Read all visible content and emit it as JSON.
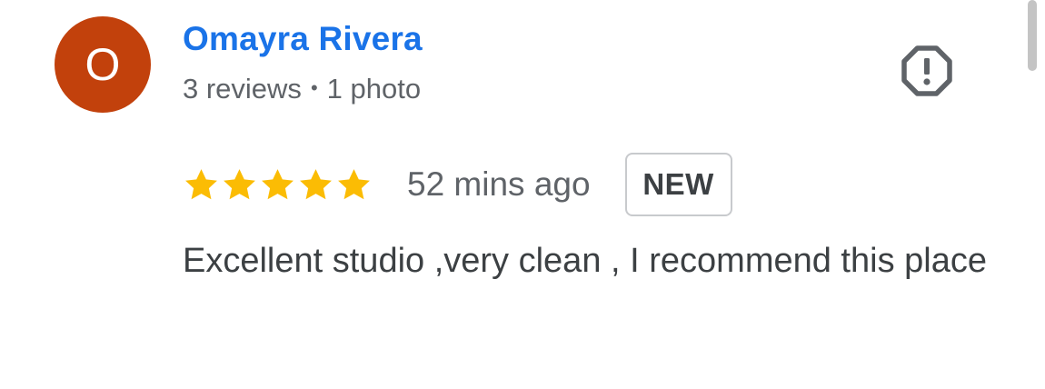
{
  "reviewer": {
    "initial": "O",
    "avatar_color": "#c2410c",
    "name": "Omayra Rivera",
    "name_color": "#1a73e8",
    "reviews_count": "3 reviews",
    "separator": "•",
    "photos_count": "1 photo"
  },
  "report": {
    "icon": "report-flag-octagon-icon"
  },
  "review": {
    "rating": 5,
    "rating_max": 5,
    "star_color": "#fbbc04",
    "time_ago": "52 mins ago",
    "badge": "NEW",
    "text": "Excellent studio ,very clean , I recommend this place"
  }
}
